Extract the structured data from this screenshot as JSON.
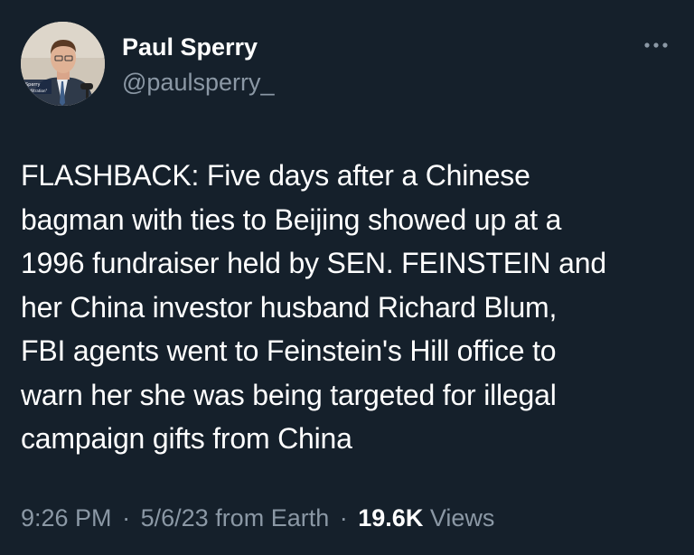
{
  "author": {
    "display_name": "Paul Sperry",
    "handle": "@paulsperry_",
    "avatar_caption_line1": "Sperry",
    "avatar_caption_line2": "\"Infiltration\""
  },
  "tweet": {
    "text": "FLASHBACK: Five days after a Chinese\nbagman with ties to Beijing showed up at a\n1996 fundraiser held by SEN. FEINSTEIN and\nher China investor husband Richard Blum,\nFBI agents went to Feinstein's Hill office to\nwarn her she was being targeted for illegal\ncampaign gifts from China",
    "time": "9:26 PM",
    "date": "5/6/23",
    "source": "from Earth",
    "separator": "·",
    "views_count": "19.6K",
    "views_label": "Views"
  },
  "icons": {
    "more": "more-horizontal-icon"
  },
  "colors": {
    "background": "#15202b",
    "primary_text": "#ffffff",
    "secondary_text": "#8b98a5"
  }
}
